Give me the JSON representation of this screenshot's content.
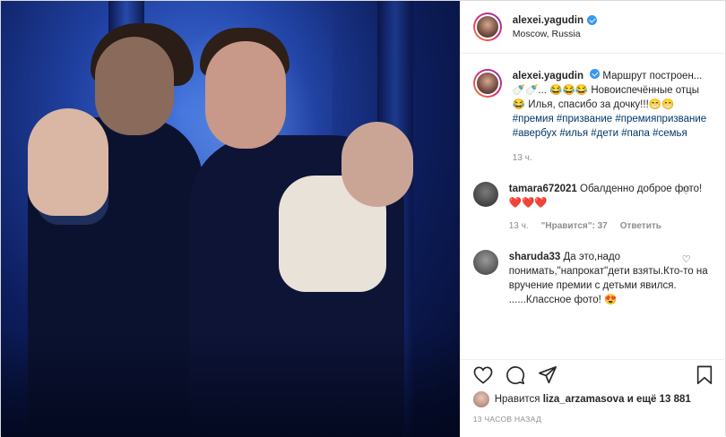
{
  "author": {
    "username": "alexei.yagudin",
    "location": "Moscow, Russia",
    "verified": true
  },
  "caption": {
    "username": "alexei.yagudin",
    "line1": "Маршрут построен... 🍼🍼... 😂😂😂",
    "line2": "Новоиспечённые отцы 😂 Илья, спасибо за дочку!!!😁😁",
    "hashtags": "#премия #призвание #премияпризвание #авербух #илья #дети #папа #семья",
    "time": "13 ч."
  },
  "comments": [
    {
      "username": "tamara672021",
      "text": "Обалденно доброе фото! ❤️❤️❤️",
      "time": "13 ч.",
      "likes": "\"Нравится\": 37",
      "reply": "Ответить"
    },
    {
      "username": "sharuda33",
      "text": "Да это,надо понимать,\"напрокат\"дети взяты.Кто-то на вручение премии с детьми явился. ......Классное фото! 😍",
      "time": "",
      "likes": "",
      "reply": ""
    }
  ],
  "footer": {
    "likes_prefix": "Нравится",
    "likes_user": "liza_arzamasova",
    "likes_suffix": "и ещё 13 881",
    "posted": "13 ЧАСОВ НАЗАД"
  },
  "icons": {
    "like": "heart-icon",
    "comment": "comment-icon",
    "share": "share-icon",
    "save": "bookmark-icon"
  },
  "colors": {
    "link": "#00376b",
    "verified": "#3897f0",
    "muted": "#8e8e8e"
  }
}
